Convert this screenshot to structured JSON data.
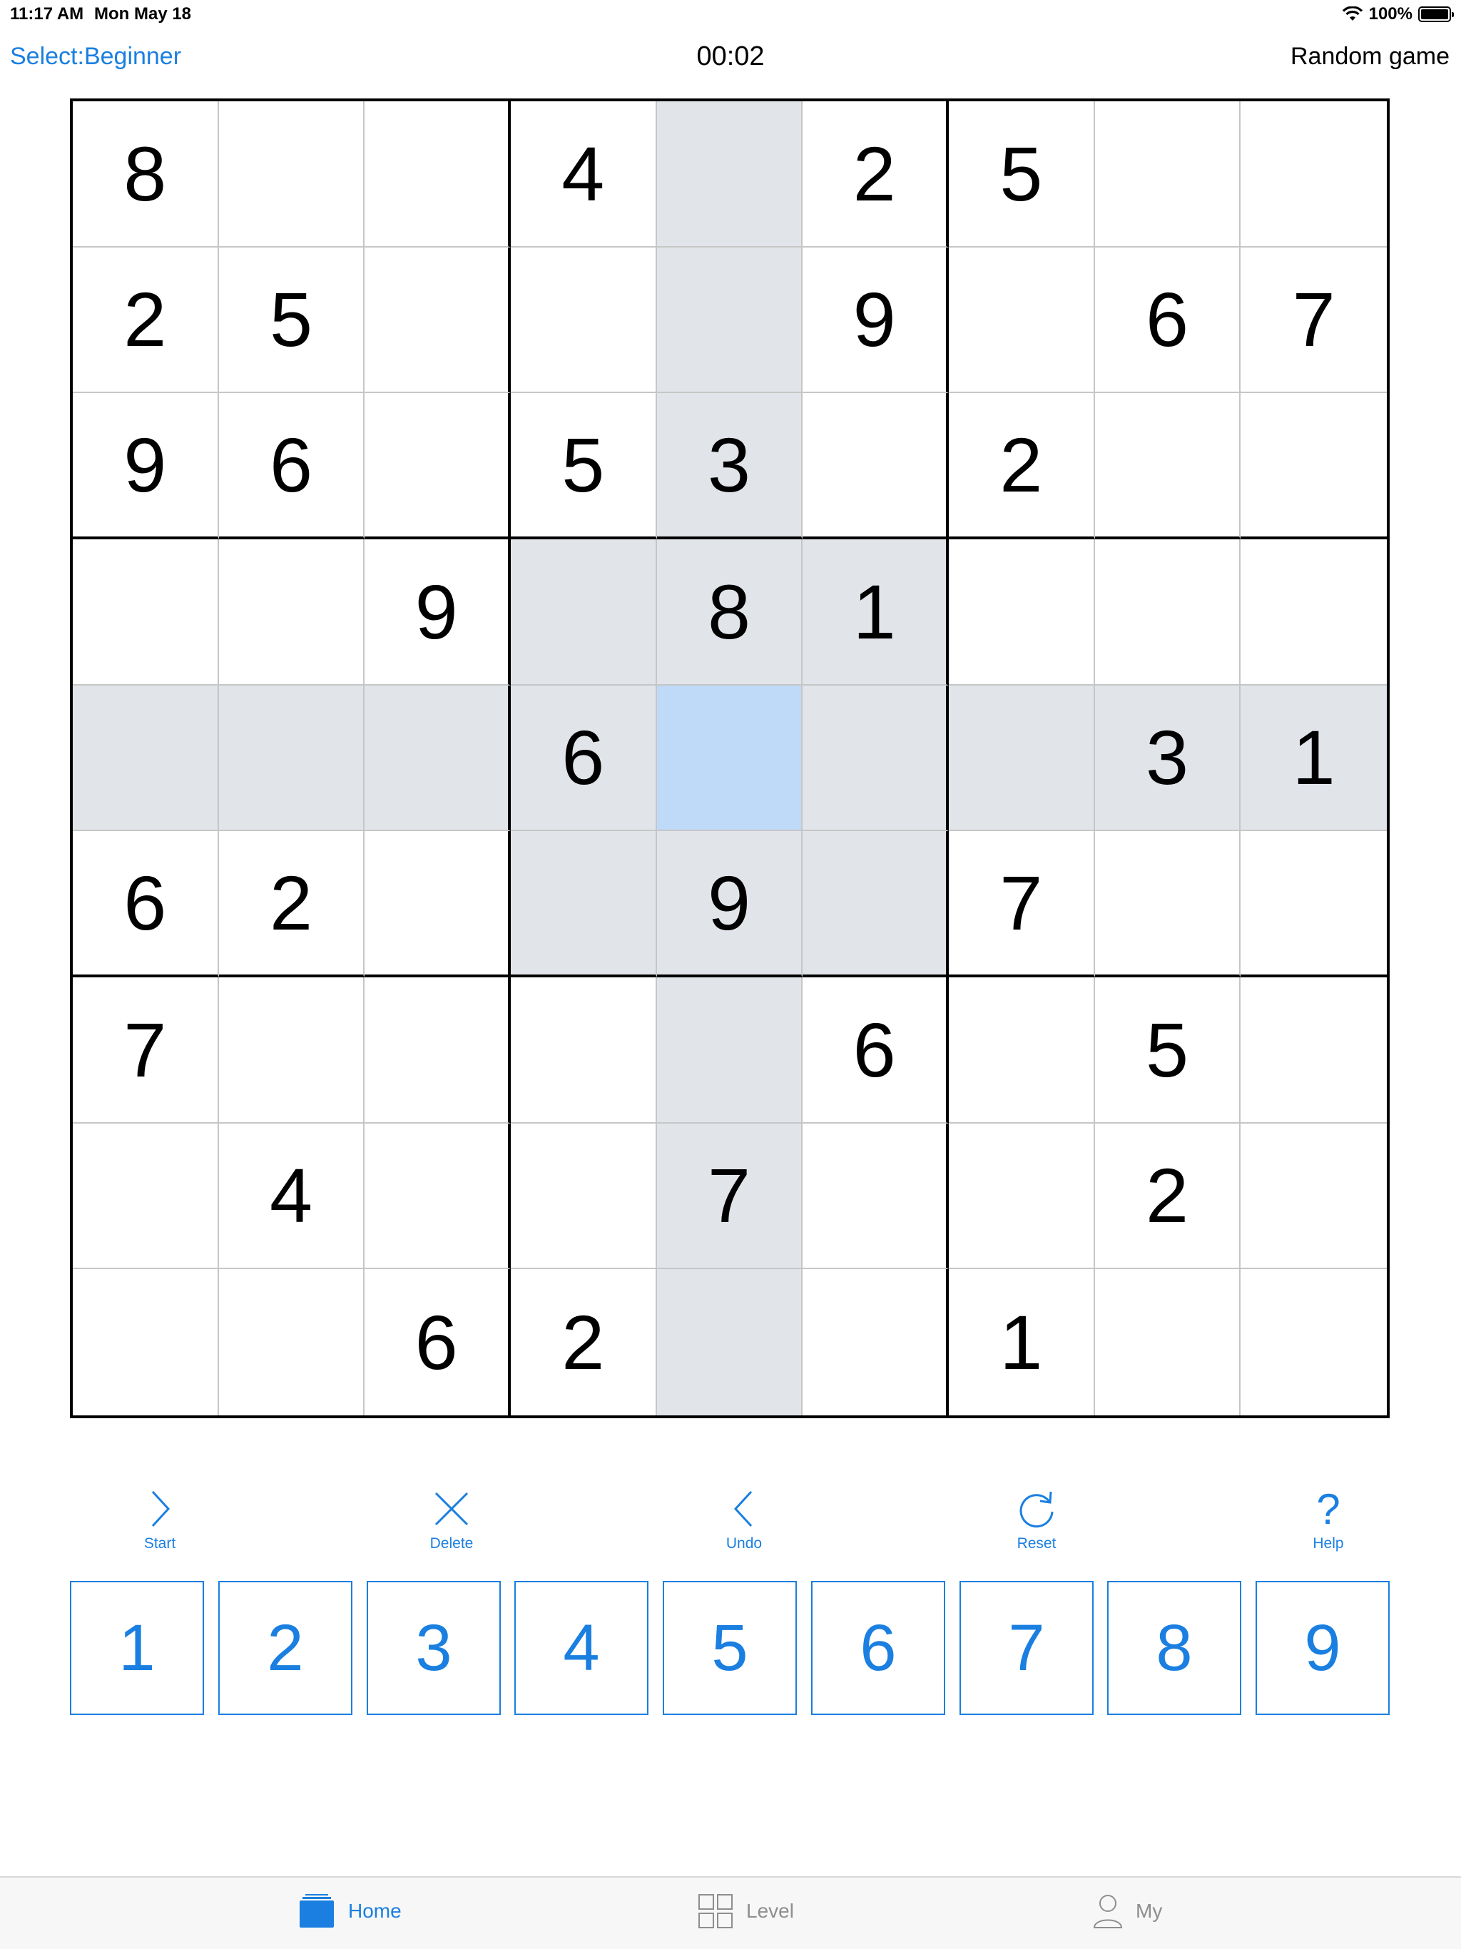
{
  "status": {
    "time": "11:17 AM",
    "date": "Mon May 18",
    "battery": "100%",
    "battery_level": 1.0
  },
  "nav": {
    "select_level": "Select:Beginner",
    "timer": "00:02",
    "random_game": "Random game"
  },
  "board": {
    "selected": [
      4,
      4
    ],
    "rows": [
      [
        "8",
        "",
        "",
        "4",
        "",
        "2",
        "5",
        "",
        ""
      ],
      [
        "2",
        "5",
        "",
        "",
        "",
        "9",
        "",
        "6",
        "7"
      ],
      [
        "9",
        "6",
        "",
        "5",
        "3",
        "",
        "2",
        "",
        ""
      ],
      [
        "",
        "",
        "9",
        "",
        "8",
        "1",
        "",
        "",
        ""
      ],
      [
        "",
        "",
        "",
        "6",
        "",
        "",
        "",
        "3",
        "1"
      ],
      [
        "6",
        "2",
        "",
        "",
        "9",
        "",
        "7",
        "",
        ""
      ],
      [
        "7",
        "",
        "",
        "",
        "",
        "6",
        "",
        "5",
        ""
      ],
      [
        "",
        "4",
        "",
        "",
        "7",
        "",
        "",
        "2",
        ""
      ],
      [
        "",
        "",
        "6",
        "2",
        "",
        "",
        "1",
        "",
        ""
      ]
    ]
  },
  "tools": [
    {
      "name": "start",
      "label": "Start",
      "icon": "chevron-right-icon"
    },
    {
      "name": "delete",
      "label": "Delete",
      "icon": "close-icon"
    },
    {
      "name": "undo",
      "label": "Undo",
      "icon": "chevron-left-icon"
    },
    {
      "name": "reset",
      "label": "Reset",
      "icon": "refresh-icon"
    },
    {
      "name": "help",
      "label": "Help",
      "icon": "question-icon"
    }
  ],
  "numpad": [
    "1",
    "2",
    "3",
    "4",
    "5",
    "6",
    "7",
    "8",
    "9"
  ],
  "tabbar": [
    {
      "label": "Home",
      "icon": "home-icon",
      "active": true
    },
    {
      "label": "Level",
      "icon": "grid-icon",
      "active": false
    },
    {
      "label": "My",
      "icon": "person-icon",
      "active": false
    }
  ],
  "colors": {
    "accent": "#1a7fe0",
    "highlight": "#e1e5ea",
    "selected": "#bfdaf9"
  }
}
